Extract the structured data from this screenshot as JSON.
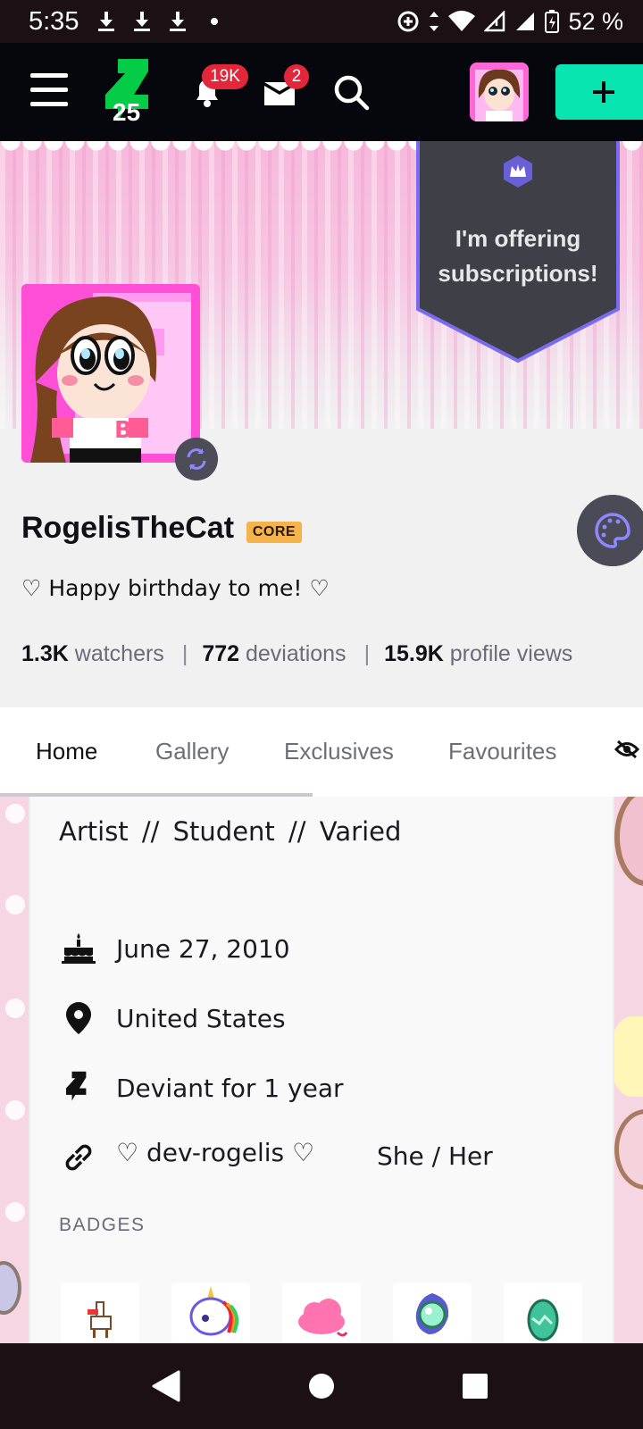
{
  "status_bar": {
    "time": "5:35",
    "battery": "52 %"
  },
  "header": {
    "logo_text": "25",
    "notifications_count": "19K",
    "messages_count": "2"
  },
  "cover": {
    "subscription_banner": "I'm offering subscriptions!"
  },
  "profile": {
    "username": "RogelisTheCat",
    "core_badge": "CORE",
    "tagline": "♡ Happy birthday to me! ♡",
    "stats": [
      {
        "value": "1.3K",
        "label": "watchers"
      },
      {
        "value": "772",
        "label": "deviations"
      },
      {
        "value": "15.9K",
        "label": "profile views"
      }
    ],
    "stat_separator": "|"
  },
  "tabs": [
    {
      "label": "Home",
      "active": true
    },
    {
      "label": "Gallery",
      "active": false
    },
    {
      "label": "Exclusives",
      "active": false
    },
    {
      "label": "Favourites",
      "active": false
    }
  ],
  "about": {
    "headline": "Artist // Student // Varied",
    "rows": [
      {
        "icon": "cake-icon",
        "text": "June 27, 2010"
      },
      {
        "icon": "location-pin-icon",
        "text": "United States"
      },
      {
        "icon": "deviantart-logo-icon",
        "text": "Deviant for 1 year"
      },
      {
        "icon": "link-icon",
        "text": "♡ dev-rogelis ♡"
      }
    ],
    "pronouns": "She / Her",
    "badges_label": "BADGES",
    "badges": [
      "llama-badge-icon",
      "unicorn-badge-icon",
      "cloud-badge-icon",
      "gem-badge-icon",
      "egg-badge-icon"
    ]
  },
  "colors": {
    "accent_green": "#08e5b0",
    "tab_underline": "#10a37f",
    "notification_red": "#e3263a",
    "core_gold": "#f4b34b",
    "banner_dark": "#3f3f48",
    "banner_border": "#7a6cf0"
  }
}
